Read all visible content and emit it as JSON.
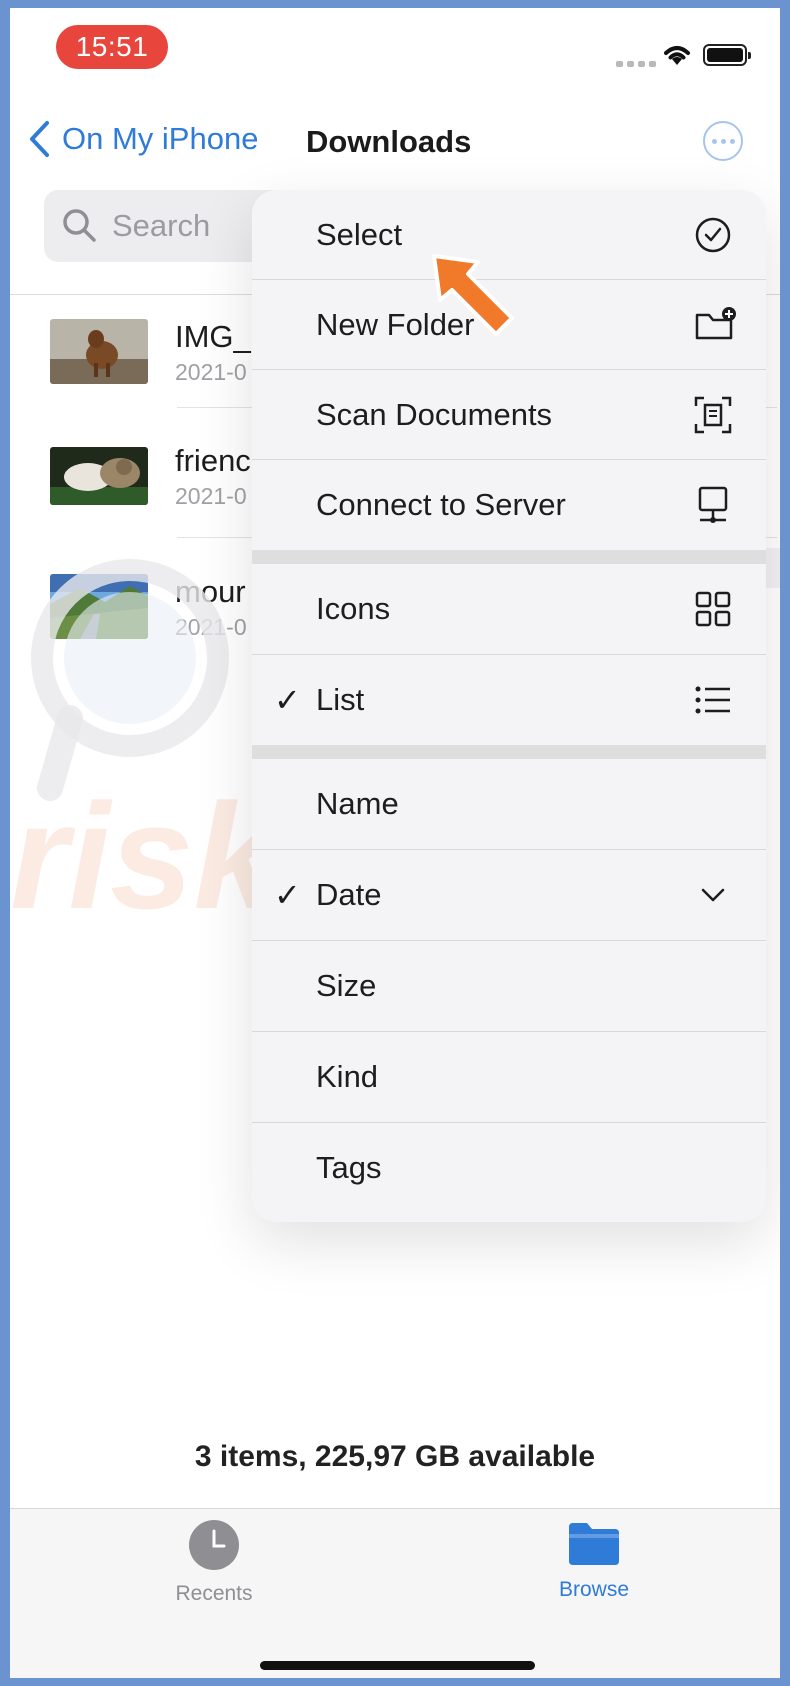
{
  "status_bar": {
    "time": "15:51"
  },
  "nav": {
    "back_label": "On My iPhone",
    "title": "Downloads"
  },
  "search": {
    "placeholder": "Search"
  },
  "files": [
    {
      "name": "IMG_",
      "date": "2021-0"
    },
    {
      "name": "frienc",
      "date": "2021-0"
    },
    {
      "name": "mour",
      "date": "2021-0"
    }
  ],
  "menu": {
    "group1": [
      {
        "label": "Select",
        "icon": "checkmark-circle-icon"
      },
      {
        "label": "New Folder",
        "icon": "folder-plus-icon"
      },
      {
        "label": "Scan Documents",
        "icon": "scan-document-icon"
      },
      {
        "label": "Connect to Server",
        "icon": "server-icon"
      }
    ],
    "group2": [
      {
        "label": "Icons",
        "icon": "grid-icon",
        "checked": false
      },
      {
        "label": "List",
        "icon": "list-icon",
        "checked": true
      }
    ],
    "group3": [
      {
        "label": "Name",
        "checked": false
      },
      {
        "label": "Date",
        "checked": true,
        "icon": "chevron-down-icon"
      },
      {
        "label": "Size",
        "checked": false
      },
      {
        "label": "Kind",
        "checked": false
      },
      {
        "label": "Tags",
        "checked": false
      }
    ],
    "check_mark": "✓"
  },
  "footer": {
    "status": "3 items, 225,97 GB available"
  },
  "tabs": [
    {
      "label": "Recents",
      "icon": "clock-icon",
      "active": false
    },
    {
      "label": "Browse",
      "icon": "folder-icon",
      "active": true
    }
  ],
  "watermark_text": "PC risk.com",
  "colors": {
    "accent": "#2f7bd8",
    "status_badge": "#e8453c",
    "arrow": "#f07a2a"
  }
}
